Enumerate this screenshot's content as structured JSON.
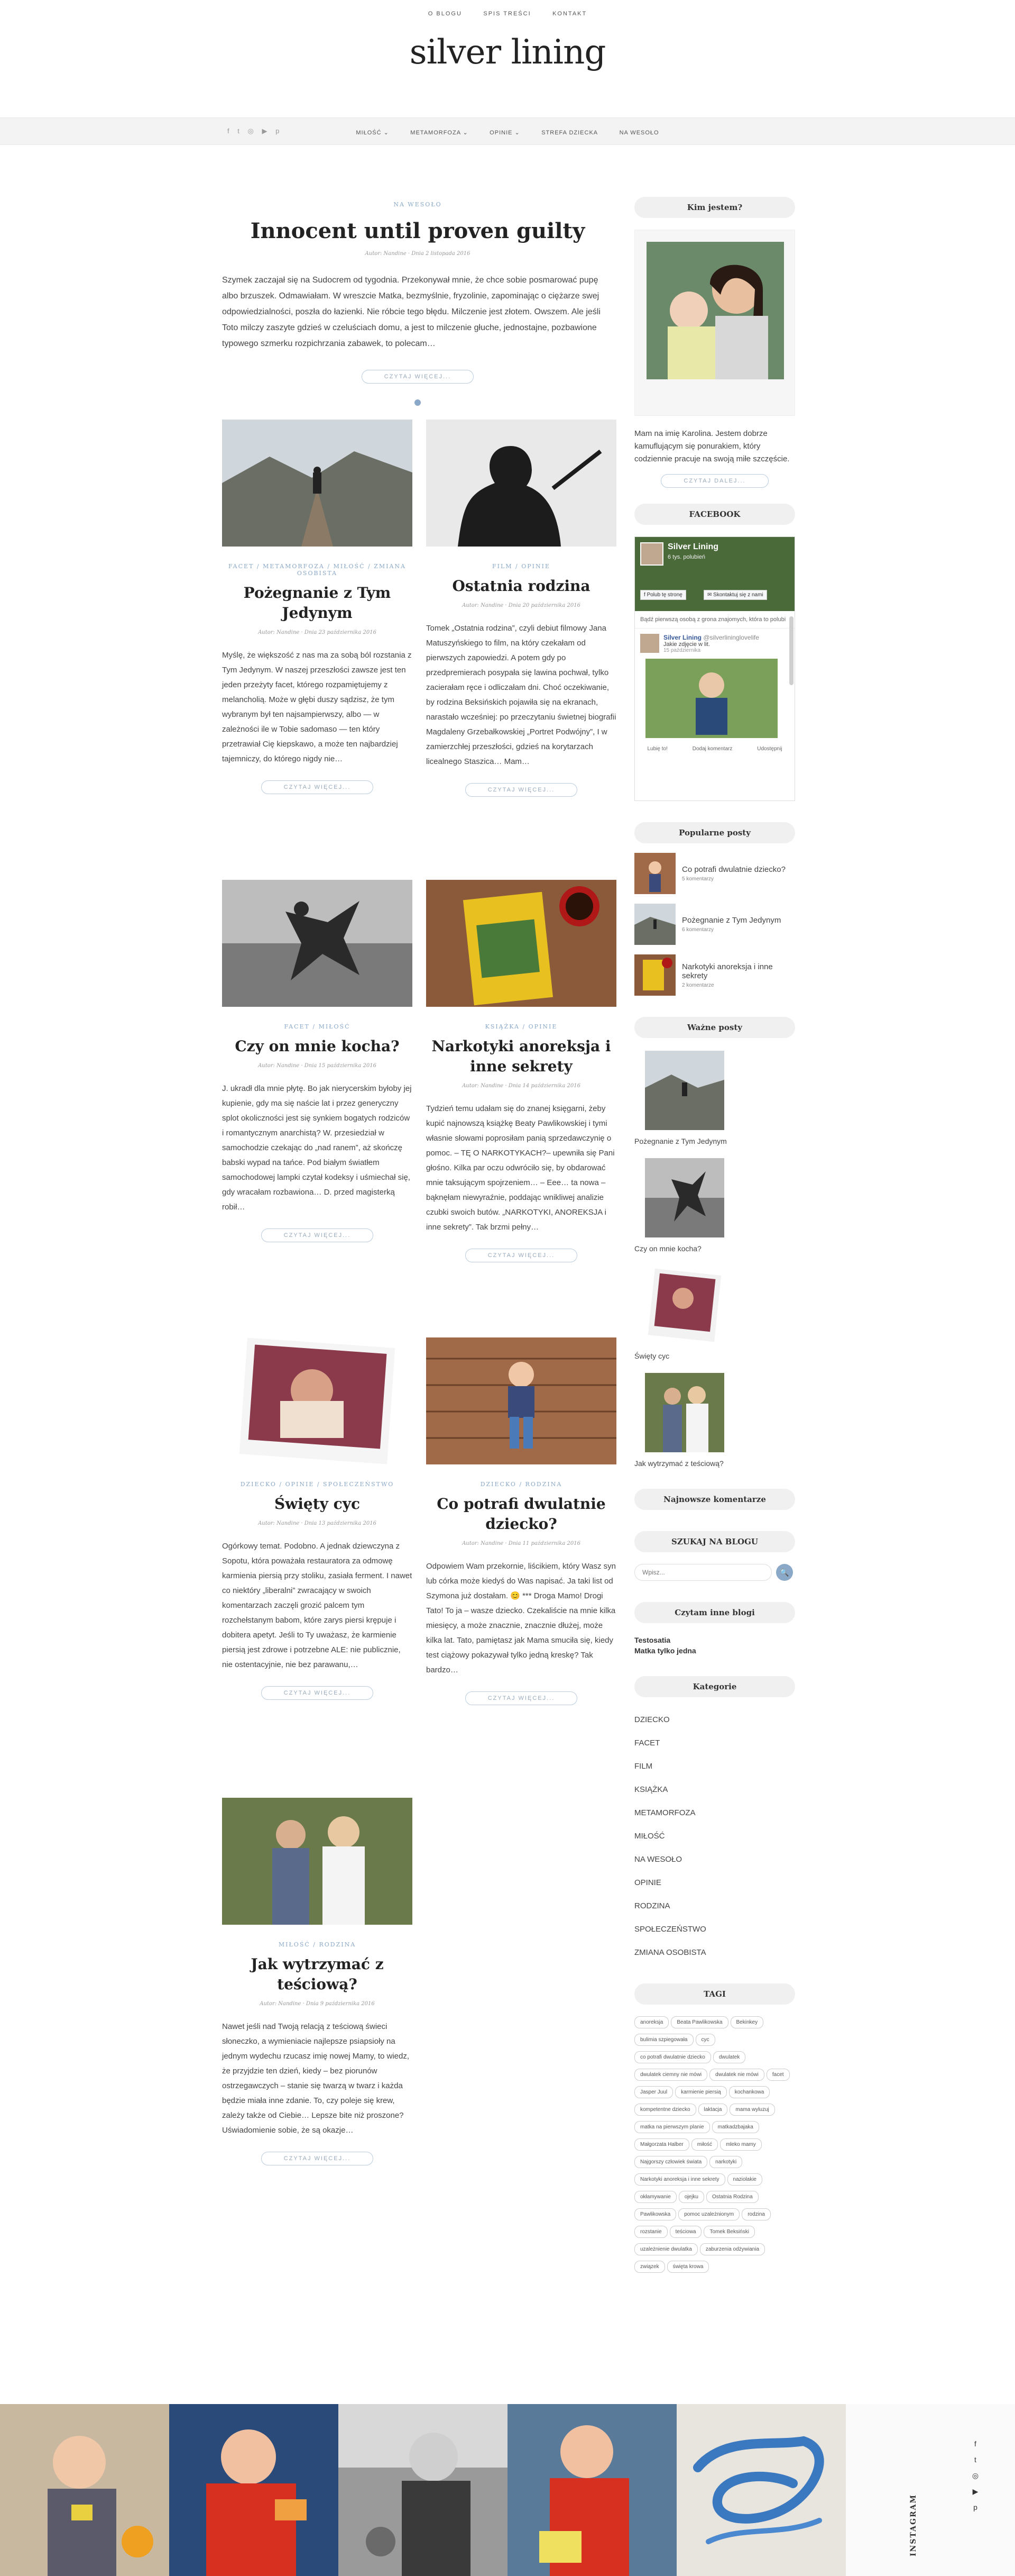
{
  "topnav": {
    "items": [
      "O BLOGU",
      "SPIS TREŚCI",
      "KONTAKT"
    ]
  },
  "site_title": "silver lining",
  "social_top": {
    "icons": [
      "facebook-icon",
      "twitter-icon",
      "instagram-icon",
      "youtube-icon",
      "pinterest-icon"
    ],
    "glyphs": [
      "f",
      "t",
      "◎",
      "▶",
      "p"
    ]
  },
  "menu": {
    "items": [
      "MIŁOŚĆ",
      "METAMORFOZA",
      "OPINIE",
      "STREFA DZIECKA",
      "NA WESOŁO"
    ],
    "dropdown_glyph": "⌄"
  },
  "featured": {
    "category": "NA WESOŁO",
    "title": "Innocent until proven guilty",
    "meta": "Autor: Nandine · Dnia 2 listopada 2016",
    "excerpt": "Szymek zaczajał się na Sudocrem od tygodnia. Przekonywał mnie, że chce sobie posmarować pupę albo brzuszek. Odmawiałam. W wreszcie Matka, bezmyślnie, fryzolinie, zapominając o ciężarze swej odpowiedzialności, poszła do łazienki. Nie róbcie tego błędu. Milczenie jest złotem. Owszem. Ale jeśli Toto milczy zaszyte gdzieś w czeluściach domu, a jest to milczenie głuche, jednostajne, pozbawione typowego szmerku rozpichrzania zabawek, to polecam…",
    "readmore": "CZYTAJ WIĘCEJ..."
  },
  "posts": [
    {
      "category": "FACET / METAMORFOZA / MIŁOŚĆ / ZMIANA OSOBISTA",
      "title": "Pożegnanie z Tym Jedynym",
      "meta": "Autor: Nandine · Dnia 23 października 2016",
      "excerpt": "Myślę, że większość z nas ma za sobą ból rozstania z Tym Jedynym. W naszej przeszłości zawsze jest ten jeden przeżyty facet, którego rozpamiętujemy z melancholią. Może w głębi duszy sądzisz, że tym wybranym był ten najsampierwszy, albo — w zależności ile w Tobie sadomaso — ten który przetrawiał Cię kiepskawo, a może ten najbardziej tajemniczy, do którego nigdy nie…",
      "readmore": "CZYTAJ WIĘCEJ..."
    },
    {
      "category": "FILM / OPINIE",
      "title": "Ostatnia rodzina",
      "meta": "Autor: Nandine · Dnia 20 października 2016",
      "excerpt": "Tomek „Ostatnia rodzina”, czyli debiut filmowy Jana Matuszyńskiego to film, na który czekałam od pierwszych zapowiedzi. A potem gdy po przedpremierach posypała się lawina pochwał, tylko zacierałam ręce i odliczałam dni. Choć oczekiwanie, by rodzina Beksińskich pojawiła się na ekranach, narastało wcześniej: po przeczytaniu świetnej biografii Magdaleny Grzebałkowskiej „Portret Podwójny”, I w zamierzchłej przeszłości, gdzieś na korytarzach licealnego Staszica… Mam…",
      "readmore": "CZYTAJ WIĘCEJ..."
    },
    {
      "category": "FACET / MIŁOŚĆ",
      "title": "Czy on mnie kocha?",
      "meta": "Autor: Nandine · Dnia 15 października 2016",
      "excerpt": "J. ukradł dla mnie płytę. Bo jak nierycerskim byłoby jej kupienie, gdy ma się naście lat i przez generyczny splot okoliczności jest się synkiem bogatych rodziców i romantycznym anarchistą? W. przesiedział w samochodzie czekając do „nad ranem”, aż skończę babski wypad na tańce. Pod białym światłem samochodowej lampki czytał kodeksy i uśmiechał się, gdy wracałam rozbawiona… D. przed magisterką robił…",
      "readmore": "CZYTAJ WIĘCEJ..."
    },
    {
      "category": "KSIĄŻKA / OPINIE",
      "title": "Narkotyki anoreksja i inne sekrety",
      "meta": "Autor: Nandine · Dnia 14 października 2016",
      "excerpt": "Tydzień temu udałam się do znanej księgarni, żeby kupić najnowszą książkę Beaty Pawlikowskiej i tymi własnie słowami poprosiłam panią sprzedawczynię o pomoc. – TĘ O NARKOTYKACH?– upewniła się Pani głośno. Kilka par oczu odwróciło się, by obdarować mnie taksującym spojrzeniem… – Eee… ta nowa – bąknęłam niewyraźnie, poddając wnikliwej analizie czubki swoich butów. „NARKOTYKI, ANOREKSJA i inne sekrety”. Tak brzmi pełny…",
      "readmore": "CZYTAJ WIĘCEJ..."
    },
    {
      "category": "DZIECKO / OPINIE / SPOŁECZEŃSTWO",
      "title": "Święty cyc",
      "meta": "Autor: Nandine · Dnia 13 października 2016",
      "excerpt": "Ogórkowy temat. Podobno. A jednak dziewczyna z Sopotu, która poważała restauratora za odmowę karmienia piersią przy stoliku, zasiała ferment. I nawet co niektóry „liberalni” zwracający w swoich komentarzach zaczęli grozić palcem tym rozchełstanym babom, które zarys piersi krępuje i dobitera apetyt. Jeśli to Ty uważasz, że karmienie piersią jest zdrowe i potrzebne ALE: nie publicznie, nie ostentacyjnie, nie bez parawanu,…",
      "readmore": "CZYTAJ WIĘCEJ..."
    },
    {
      "category": "DZIECKO / RODZINA",
      "title": "Co potrafi dwulatnie dziecko?",
      "meta": "Autor: Nandine · Dnia 11 października 2016",
      "excerpt": "Odpowiem Wam przekornie, liścikiem, który Wasz syn lub córka może kiedyś do Was napisać. Ja taki list od Szymona już dostałam. 😊 *** Droga Mamo! Drogi Tato! To ja – wasze dziecko. Czekaliście na mnie kilka miesięcy, a może znacznie, znacznie dłużej, może kilka lat. Tato, pamiętasz jak Mama smuciła się, kiedy test ciążowy pokazywał tylko jedną kreskę? Tak bardzo…",
      "readmore": "CZYTAJ WIĘCEJ..."
    },
    {
      "category": "MIŁOŚĆ / RODZINA",
      "title": "Jak wytrzymać z teściową?",
      "meta": "Autor: Nandine · Dnia 9 października 2016",
      "excerpt": "Nawet jeśli nad Twoją relacją z teściową świeci słoneczko, a wymieniacie najlepsze psiapsioły na jednym wydechu rzucasz imię nowej Mamy, to wiedz, że przyjdzie ten dzień, kiedy – bez piorunów ostrzegawczych – stanie się twarzą w twarz i każda będzie miała inne zdanie. To, czy poleje się krew, zależy także od Ciebie… Lepsze bite niż proszone? Uświadomienie sobie, że są okazje…",
      "readmore": "CZYTAJ WIĘCEJ..."
    }
  ],
  "sidebar": {
    "about": {
      "title": "Kim jestem?",
      "text": "Mam na imię Karolina. Jestem dobrze kamuflującym się ponurakiem, który codziennie pracuje na swoją miłe szczęście.",
      "readmore": "CZYTAJ DALEJ..."
    },
    "facebook": {
      "title": "FACEBOOK",
      "page_name": "Silver Lining",
      "page_sub": "6 tys. polubień",
      "follow_btn": "Polub tę stronę",
      "share_btn": "Skontaktuj się z nami",
      "friend_note": "Bądź pierwszą osobą z grona znajomych, która to polubi",
      "post_author": "Silver Lining",
      "post_author_sub": "@silverlininglovelife",
      "post_text": "Jakie zdjęcie w lit.",
      "post_date": "15 października",
      "actions": [
        "Lubię to!",
        "Dodaj komentarz",
        "Udostępnij"
      ]
    },
    "popular": {
      "title": "Popularne posty",
      "items": [
        {
          "title": "Co potrafi dwulatnie dziecko?",
          "comments": "5 komentarzy"
        },
        {
          "title": "Pożegnanie z Tym Jedynym",
          "comments": "6 komentarzy"
        },
        {
          "title": "Narkotyki anoreksja i inne sekrety",
          "comments": "2 komentarze"
        }
      ]
    },
    "important": {
      "title": "Ważne posty",
      "items": [
        "Pożegnanie z Tym Jedynym",
        "Czy on mnie kocha?",
        "Święty cyc",
        "Jak wytrzymać z teściową?"
      ]
    },
    "latest_comments": {
      "title": "Najnowsze komentarze"
    },
    "search": {
      "title": "SZUKAJ NA BLOGU",
      "placeholder": "Wpisz...",
      "icon": "🔍"
    },
    "blogs": {
      "title": "Czytam inne blogi",
      "items": [
        "Testosatia",
        "Matka tylko jedna"
      ]
    },
    "categories": {
      "title": "Kategorie",
      "items": [
        "DZIECKO",
        "FACET",
        "FILM",
        "KSIĄŻKA",
        "METAMORFOZA",
        "MIŁOŚĆ",
        "NA WESOŁO",
        "OPINIE",
        "RODZINA",
        "SPOŁECZEŃSTWO",
        "ZMIANA OSOBISTA"
      ]
    },
    "tags": {
      "title": "TAGI",
      "items": [
        "anoreksja",
        "Beata Pawlikowska",
        "Bekinkey",
        "bulimia szpiegowała",
        "cyc",
        "co potrafi dwulatnie dziecko",
        "dwulatek",
        "dwulatek ciemny nie mówi",
        "dwulatek nie mówi",
        "facet",
        "Jasper Juul",
        "karmienie piersią",
        "kochankowa",
        "kompetentne dziecko",
        "laktacja",
        "mama wyluzuj",
        "matka na pierwszym planie",
        "matkadzbajaka",
        "Małgorzata Halber",
        "miłość",
        "mleko mamy",
        "Najgorszy człowiek świata",
        "narkotyki",
        "Narkotyki anoreksja i inne sekrety",
        "naziolakie",
        "okłamywanie",
        "ojejku",
        "Ostatnia Rodzina",
        "Pawlikowska",
        "pomoc uzależnionym",
        "rodzina",
        "rozstanie",
        "teściowa",
        "Tomek Beksiński",
        "uzależnienie dwulatka",
        "zaburzenia odżywiania",
        "związek",
        "święta krowa"
      ]
    }
  },
  "instagram": {
    "label": "INSTAGRAM",
    "social_glyphs": [
      "f",
      "t",
      "◎",
      "▶",
      "p"
    ]
  },
  "colors": {
    "accent": "#8aa8c8",
    "menubar": "#f3f3f3",
    "widget_bg": "#f0f0f0"
  }
}
